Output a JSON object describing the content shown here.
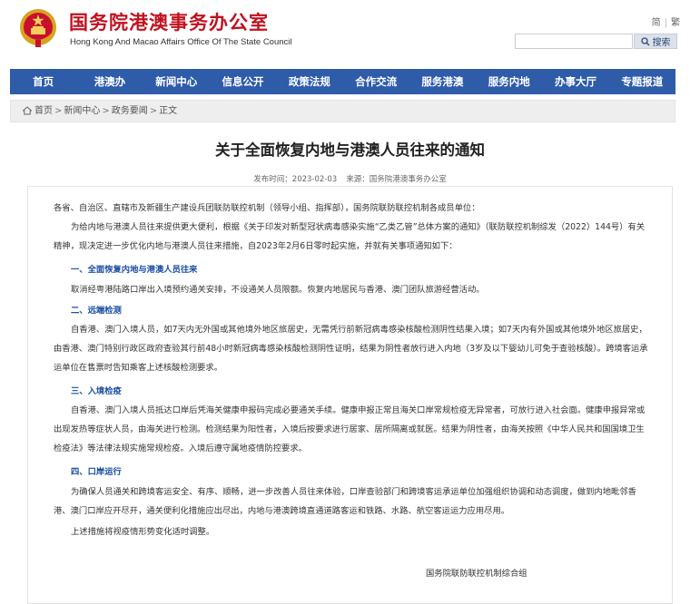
{
  "header": {
    "site_title": "国务院港澳事务办公室",
    "site_subtitle": "Hong Kong And Macao Affairs Office Of The State Council",
    "links": [
      "简",
      "繁"
    ],
    "search": {
      "placeholder": "",
      "button_label": "搜索"
    }
  },
  "nav": {
    "items": [
      "首页",
      "港澳办",
      "新闻中心",
      "信息公开",
      "政策法规",
      "合作交流",
      "服务港澳",
      "服务内地",
      "办事大厅",
      "专题报道"
    ]
  },
  "breadcrumb": {
    "items": [
      "首页",
      "新闻中心",
      "政务要闻",
      "正文"
    ]
  },
  "article": {
    "title": "关于全面恢复内地与港澳人员往来的通知",
    "publish_label": "发布时间：",
    "publish_date": "2023-02-03",
    "source_label": "来源：",
    "source": "国务院港澳事务办公室",
    "paragraphs": [
      "各省、自治区、直辖市及新疆生产建设兵团联防联控机制（领导小组、指挥部），国务院联防联控机制各成员单位：",
      "为给内地与港澳人员往来提供更大便利，根据《关于印发对新型冠状病毒感染实施“乙类乙管”总体方案的通知》（联防联控机制综发（2022）144号）有关精神，现决定进一步优化内地与港澳人员往来措施，自2023年2月6日零时起实施，并就有关事项通知如下：",
      "一、全面恢复内地与港澳人员往来",
      "取消经粤港陆路口岸出入境预约通关安排，不设通关人员限额。恢复内地居民与香港、澳门团队旅游经营活动。",
      "二、远端检测",
      "自香港、澳门入境人员，如7天内无外国或其他境外地区旅居史，无需凭行前新冠病毒感染核酸检测阴性结果入境；如7天内有外国或其他境外地区旅居史，由香港、澳门特别行政区政府查验其行前48小时新冠病毒感染核酸检测阴性证明，结果为阴性者放行进入内地（3岁及以下婴幼儿可免于查验核酸）。跨境客运承运单位在售票时告知乘客上述核酸检测要求。",
      "三、入境检疫",
      "自香港、澳门入境人员抵达口岸后凭海关健康申报码完成必要通关手续。健康申报正常且海关口岸常规检疫无异常者，可放行进入社会面。健康申报异常或出现发热等症状人员，由海关进行检测。检测结果为阳性者，入境后按要求进行居家、居所隔离或就医。结果为阴性者，由海关按照《中华人民共和国国境卫生检疫法》等法律法规实施常规检疫。入境后遵守属地疫情防控要求。",
      "四、口岸运行",
      "为确保人员通关和跨境客运安全、有序、顺畅，进一步改善人员往来体验，口岸查验部门和跨境客运承运单位加强组织协调和动态调度，做到内地毗邻香港、澳门口岸应开尽开，通关便利化措施应出尽出，内地与港澳跨境直通道路客运和铁路、水路、航空客运运力应用尽用。",
      "上述措施将视疫情形势变化适时调整。"
    ],
    "signature": "国务院联防联控机制综合组"
  },
  "colors": {
    "brand_red": "#c1121f",
    "nav_blue": "#2f5ca8",
    "heading_blue": "#1d4fa1"
  }
}
